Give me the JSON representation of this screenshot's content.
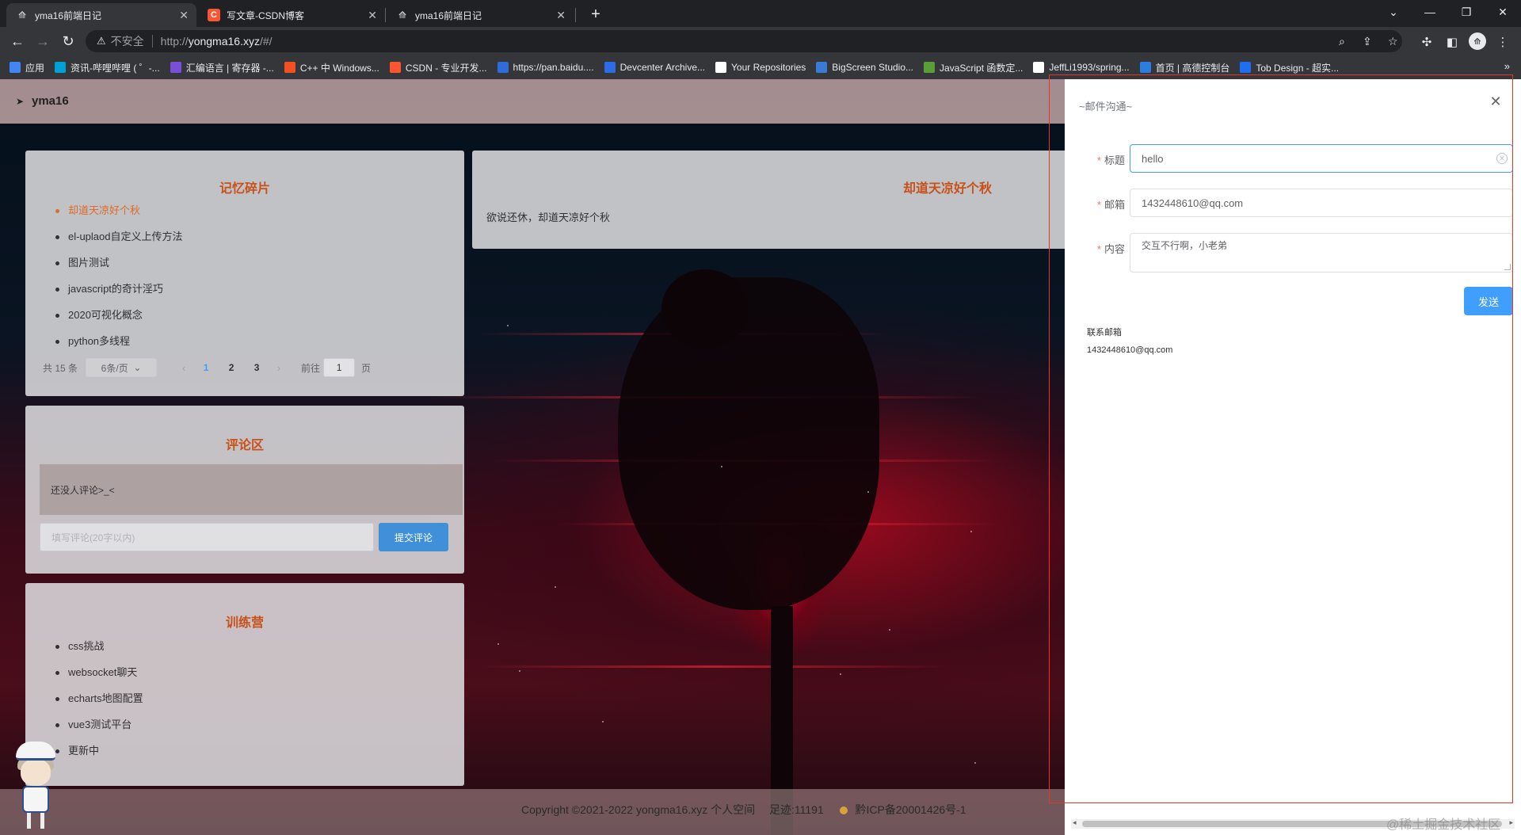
{
  "browser": {
    "tabs": [
      {
        "title": "yma16前端日记",
        "active": true,
        "favicon": "yma-logo-icon"
      },
      {
        "title": "写文章-CSDN博客",
        "active": false,
        "favicon": "csdn-icon"
      },
      {
        "title": "yma16前端日记",
        "active": false,
        "favicon": "yma-logo-icon"
      }
    ],
    "address": {
      "security_label": "不安全",
      "url_prefix": "http://",
      "url_host": "yongma16.xyz",
      "url_path": "/#/"
    },
    "bookmarks": [
      {
        "label": "应用",
        "color": "#4285f4"
      },
      {
        "label": "资讯-哔哩哔哩 ( ゜-...",
        "color": "#00a1d6"
      },
      {
        "label": "汇编语言 | 寄存器 -...",
        "color": "#7a4fd8"
      },
      {
        "label": "C++ 中 Windows...",
        "color": "#f25022"
      },
      {
        "label": "CSDN - 专业开发...",
        "color": "#fc5531"
      },
      {
        "label": "https://pan.baidu....",
        "color": "#2f6bd9"
      },
      {
        "label": "Devcenter Archive...",
        "color": "#2e6be6"
      },
      {
        "label": "Your Repositories",
        "color": "#ffffff"
      },
      {
        "label": "BigScreen Studio...",
        "color": "#3b7bd6"
      },
      {
        "label": "JavaScript 函数定...",
        "color": "#5a9e3a"
      },
      {
        "label": "JeffLi1993/spring...",
        "color": "#ffffff"
      },
      {
        "label": "首页 | 高德控制台",
        "color": "#2b7de0"
      },
      {
        "label": "Tob Design - 超实...",
        "color": "#1d6ef0"
      }
    ]
  },
  "site": {
    "logo": "yma16",
    "memory_card": {
      "title": "记忆碎片",
      "items": [
        "却道天凉好个秋",
        "el-uplaod自定义上传方法",
        "图片测试",
        "javascript的奇计淫巧",
        "2020可视化概念",
        "python多线程"
      ],
      "active_index": 0,
      "pager": {
        "total": "共 15 条",
        "page_size": "6条/页",
        "pages": [
          "1",
          "2",
          "3"
        ],
        "current": 1,
        "goto_label": "前往",
        "goto_value": "1",
        "page_unit": "页"
      }
    },
    "comment_card": {
      "title": "评论区",
      "empty_text": "还没人评论>_<",
      "input_placeholder": "填写评论(20字以内)",
      "submit_label": "提交评论"
    },
    "training_card": {
      "title": "训练营",
      "items": [
        "css挑战",
        "websocket聊天",
        "echarts地图配置",
        "vue3测试平台",
        "更新中"
      ]
    },
    "article_card": {
      "title": "却道天凉好个秋",
      "excerpt": "欲说还休，却道天凉好个秋"
    },
    "footer": {
      "copyright": "Copyright ©2021-2022 yongma16.xyz 个人空间",
      "visits": "足迹:11191",
      "icp": "黔ICP备20001426号-1"
    }
  },
  "drawer": {
    "title": "~邮件沟通~",
    "fields": {
      "subject": {
        "label": "标题",
        "value": "hello"
      },
      "email": {
        "label": "邮箱",
        "value": "1432448610@qq.com"
      },
      "content": {
        "label": "内容",
        "value": "交互不行啊，小老弟"
      }
    },
    "send_label": "发送",
    "contact_label": "联系邮箱",
    "contact_email": "1432448610@qq.com"
  },
  "watermark": "@稀土掘金技术社区",
  "colors": {
    "accent": "#409eff",
    "title_orange": "#c8511a",
    "active_link": "#e06a26",
    "required_star": "#f56c6c"
  }
}
